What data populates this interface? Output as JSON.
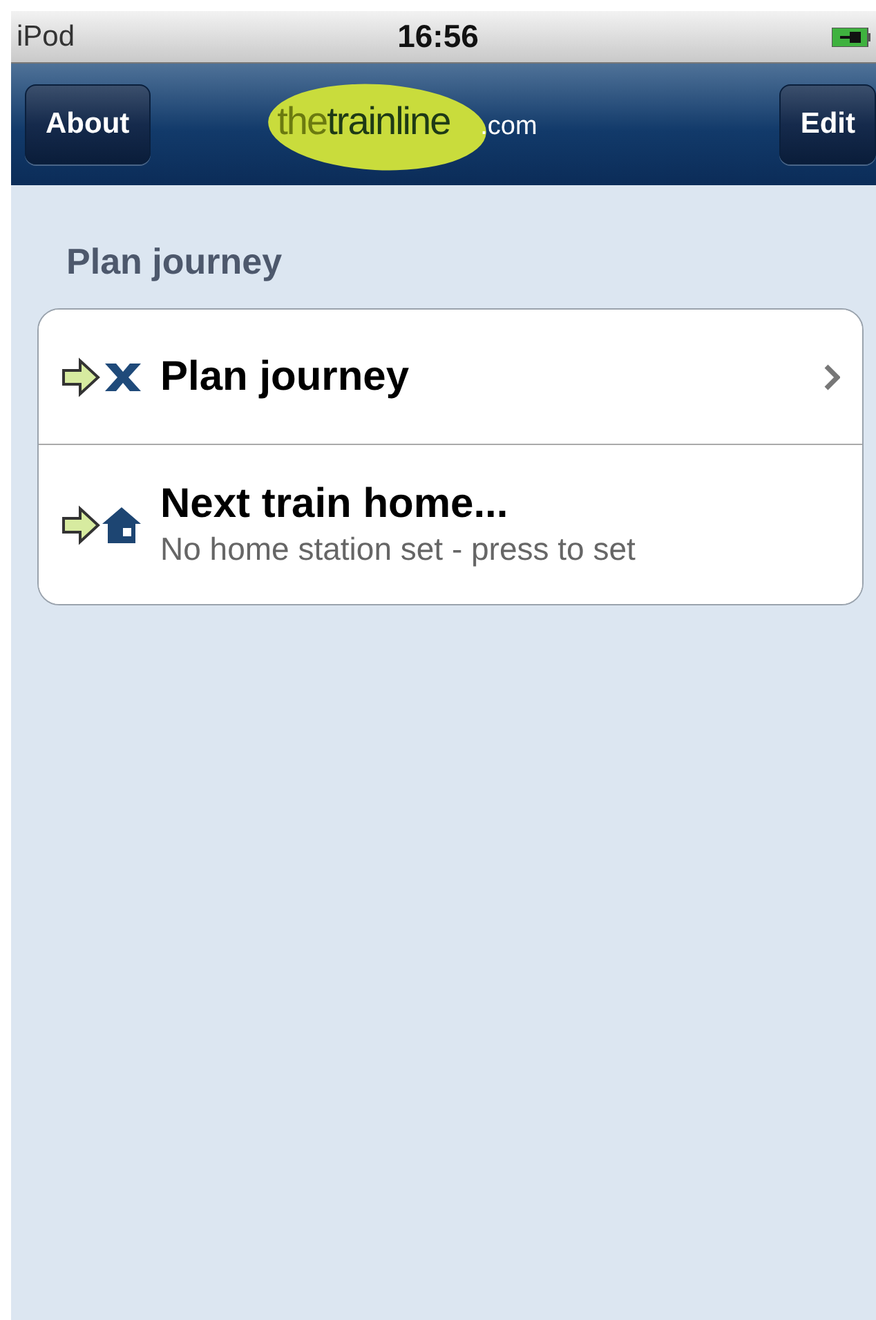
{
  "status_bar": {
    "carrier": "iPod",
    "time": "16:56"
  },
  "nav_bar": {
    "left_button": "About",
    "logo": [
      "the",
      "trainline",
      ".com"
    ],
    "right_button": "Edit"
  },
  "section": {
    "header": "Plan journey",
    "items": [
      {
        "kind": "cross",
        "title": "Plan journey",
        "chevron": true
      },
      {
        "kind": "house",
        "title": "Next train home...",
        "subtitle": "No home station set - press to set",
        "chevron": false
      }
    ]
  }
}
